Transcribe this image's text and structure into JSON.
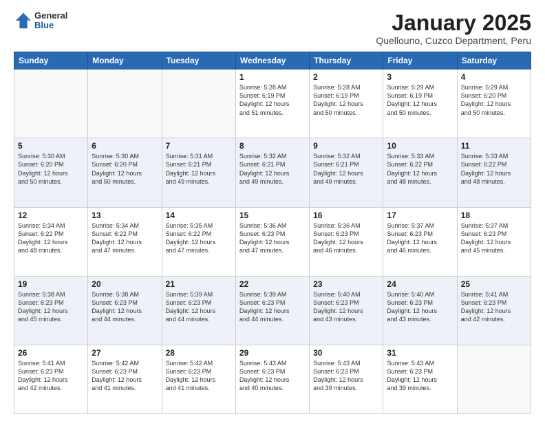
{
  "header": {
    "logo": {
      "general": "General",
      "blue": "Blue"
    },
    "title": "January 2025",
    "subtitle": "Quellouno, Cuzco Department, Peru"
  },
  "days_of_week": [
    "Sunday",
    "Monday",
    "Tuesday",
    "Wednesday",
    "Thursday",
    "Friday",
    "Saturday"
  ],
  "weeks": [
    [
      {
        "day": "",
        "info": ""
      },
      {
        "day": "",
        "info": ""
      },
      {
        "day": "",
        "info": ""
      },
      {
        "day": "1",
        "info": "Sunrise: 5:28 AM\nSunset: 6:19 PM\nDaylight: 12 hours\nand 51 minutes."
      },
      {
        "day": "2",
        "info": "Sunrise: 5:28 AM\nSunset: 6:19 PM\nDaylight: 12 hours\nand 50 minutes."
      },
      {
        "day": "3",
        "info": "Sunrise: 5:29 AM\nSunset: 6:19 PM\nDaylight: 12 hours\nand 50 minutes."
      },
      {
        "day": "4",
        "info": "Sunrise: 5:29 AM\nSunset: 6:20 PM\nDaylight: 12 hours\nand 50 minutes."
      }
    ],
    [
      {
        "day": "5",
        "info": "Sunrise: 5:30 AM\nSunset: 6:20 PM\nDaylight: 12 hours\nand 50 minutes."
      },
      {
        "day": "6",
        "info": "Sunrise: 5:30 AM\nSunset: 6:20 PM\nDaylight: 12 hours\nand 50 minutes."
      },
      {
        "day": "7",
        "info": "Sunrise: 5:31 AM\nSunset: 6:21 PM\nDaylight: 12 hours\nand 49 minutes."
      },
      {
        "day": "8",
        "info": "Sunrise: 5:32 AM\nSunset: 6:21 PM\nDaylight: 12 hours\nand 49 minutes."
      },
      {
        "day": "9",
        "info": "Sunrise: 5:32 AM\nSunset: 6:21 PM\nDaylight: 12 hours\nand 49 minutes."
      },
      {
        "day": "10",
        "info": "Sunrise: 5:33 AM\nSunset: 6:22 PM\nDaylight: 12 hours\nand 48 minutes."
      },
      {
        "day": "11",
        "info": "Sunrise: 5:33 AM\nSunset: 6:22 PM\nDaylight: 12 hours\nand 48 minutes."
      }
    ],
    [
      {
        "day": "12",
        "info": "Sunrise: 5:34 AM\nSunset: 6:22 PM\nDaylight: 12 hours\nand 48 minutes."
      },
      {
        "day": "13",
        "info": "Sunrise: 5:34 AM\nSunset: 6:22 PM\nDaylight: 12 hours\nand 47 minutes."
      },
      {
        "day": "14",
        "info": "Sunrise: 5:35 AM\nSunset: 6:22 PM\nDaylight: 12 hours\nand 47 minutes."
      },
      {
        "day": "15",
        "info": "Sunrise: 5:36 AM\nSunset: 6:23 PM\nDaylight: 12 hours\nand 47 minutes."
      },
      {
        "day": "16",
        "info": "Sunrise: 5:36 AM\nSunset: 6:23 PM\nDaylight: 12 hours\nand 46 minutes."
      },
      {
        "day": "17",
        "info": "Sunrise: 5:37 AM\nSunset: 6:23 PM\nDaylight: 12 hours\nand 46 minutes."
      },
      {
        "day": "18",
        "info": "Sunrise: 5:37 AM\nSunset: 6:23 PM\nDaylight: 12 hours\nand 45 minutes."
      }
    ],
    [
      {
        "day": "19",
        "info": "Sunrise: 5:38 AM\nSunset: 6:23 PM\nDaylight: 12 hours\nand 45 minutes."
      },
      {
        "day": "20",
        "info": "Sunrise: 5:38 AM\nSunset: 6:23 PM\nDaylight: 12 hours\nand 44 minutes."
      },
      {
        "day": "21",
        "info": "Sunrise: 5:39 AM\nSunset: 6:23 PM\nDaylight: 12 hours\nand 44 minutes."
      },
      {
        "day": "22",
        "info": "Sunrise: 5:39 AM\nSunset: 6:23 PM\nDaylight: 12 hours\nand 44 minutes."
      },
      {
        "day": "23",
        "info": "Sunrise: 5:40 AM\nSunset: 6:23 PM\nDaylight: 12 hours\nand 43 minutes."
      },
      {
        "day": "24",
        "info": "Sunrise: 5:40 AM\nSunset: 6:23 PM\nDaylight: 12 hours\nand 43 minutes."
      },
      {
        "day": "25",
        "info": "Sunrise: 5:41 AM\nSunset: 6:23 PM\nDaylight: 12 hours\nand 42 minutes."
      }
    ],
    [
      {
        "day": "26",
        "info": "Sunrise: 5:41 AM\nSunset: 6:23 PM\nDaylight: 12 hours\nand 42 minutes."
      },
      {
        "day": "27",
        "info": "Sunrise: 5:42 AM\nSunset: 6:23 PM\nDaylight: 12 hours\nand 41 minutes."
      },
      {
        "day": "28",
        "info": "Sunrise: 5:42 AM\nSunset: 6:23 PM\nDaylight: 12 hours\nand 41 minutes."
      },
      {
        "day": "29",
        "info": "Sunrise: 5:43 AM\nSunset: 6:23 PM\nDaylight: 12 hours\nand 40 minutes."
      },
      {
        "day": "30",
        "info": "Sunrise: 5:43 AM\nSunset: 6:23 PM\nDaylight: 12 hours\nand 39 minutes."
      },
      {
        "day": "31",
        "info": "Sunrise: 5:43 AM\nSunset: 6:23 PM\nDaylight: 12 hours\nand 39 minutes."
      },
      {
        "day": "",
        "info": ""
      }
    ]
  ]
}
